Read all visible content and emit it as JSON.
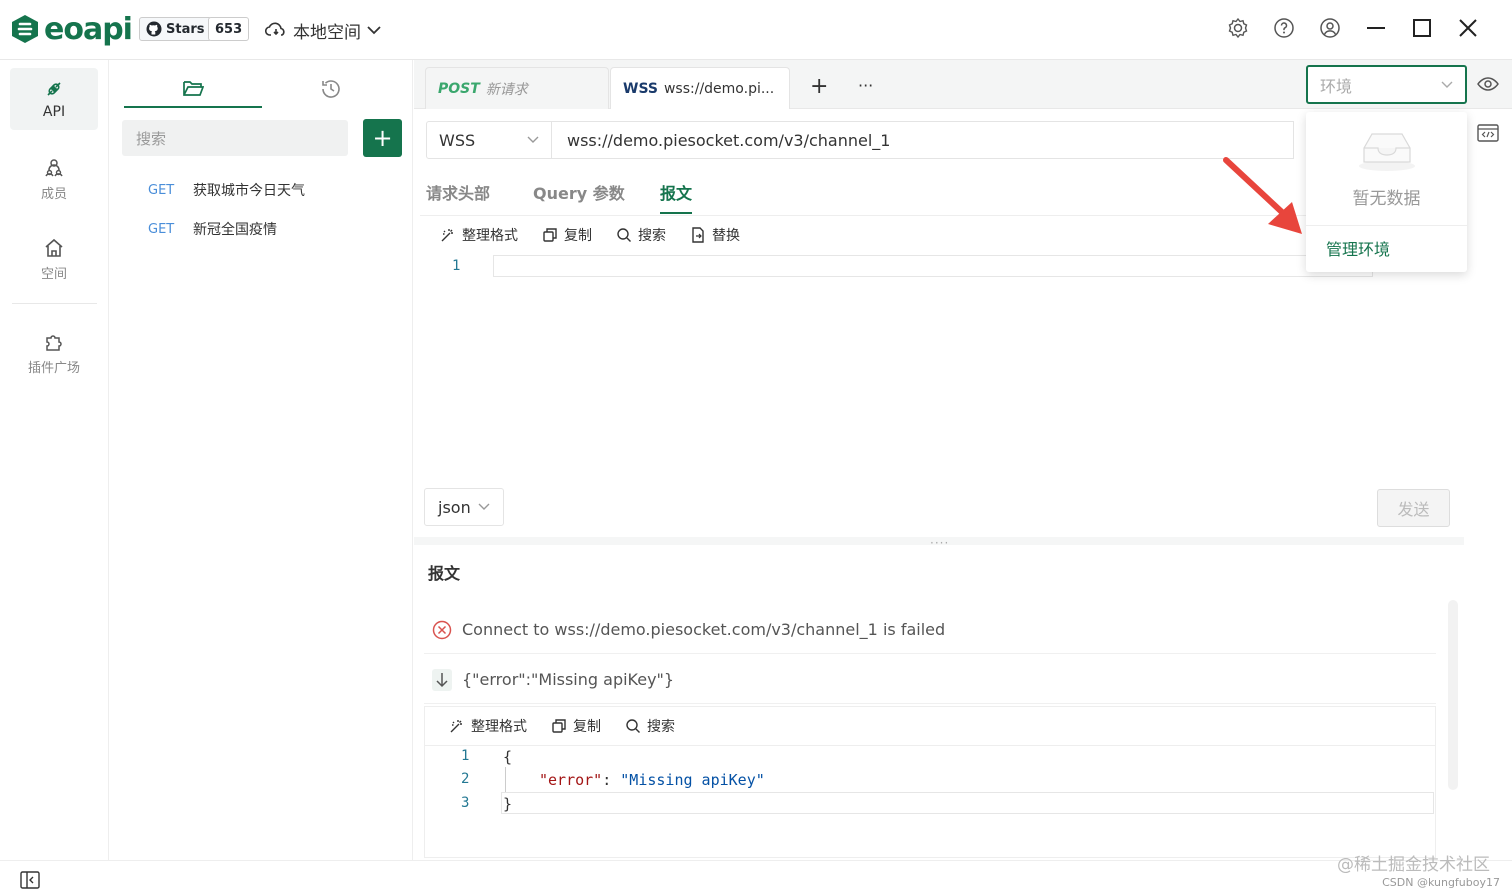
{
  "app": {
    "logo_text": "eoapi",
    "stars_label": "Stars",
    "stars_count": "653",
    "workspace": "本地空间"
  },
  "leftnav": {
    "items": [
      {
        "label": "API"
      },
      {
        "label": "成员"
      },
      {
        "label": "空间"
      },
      {
        "label": "插件广场"
      }
    ]
  },
  "sidebar": {
    "search_placeholder": "搜索",
    "add_label": "+",
    "apis": [
      {
        "method": "GET",
        "name": "获取城市今日天气"
      },
      {
        "method": "GET",
        "name": "新冠全国疫情"
      }
    ]
  },
  "tabs": [
    {
      "method": "POST",
      "title": "新请求"
    },
    {
      "method": "WSS",
      "title": "wss://demo.pi..."
    }
  ],
  "tab_controls": {
    "add": "+",
    "more": "···"
  },
  "env": {
    "placeholder": "环境",
    "empty_text": "暂无数据",
    "manage_label": "管理环境"
  },
  "request": {
    "method": "WSS",
    "url": "wss://demo.piesocket.com/v3/channel_1",
    "sub_tabs": [
      "请求头部",
      "Query 参数",
      "报文"
    ],
    "toolbar": [
      "整理格式",
      "复制",
      "搜索",
      "替换"
    ],
    "line_numbers": [
      "1"
    ],
    "format": "json",
    "send_label": "发送"
  },
  "response": {
    "title": "报文",
    "messages": [
      {
        "type": "error",
        "text": "Connect to wss://demo.piesocket.com/v3/channel_1 is failed"
      },
      {
        "type": "received",
        "text": "{\"error\":\"Missing apiKey\"}"
      }
    ],
    "toolbar": [
      "整理格式",
      "复制",
      "搜索"
    ],
    "code_lines": [
      {
        "no": "1",
        "text": "{"
      },
      {
        "no": "2",
        "key": "\"error\"",
        "colon": ": ",
        "value": "\"Missing apiKey\""
      },
      {
        "no": "3",
        "text": "}"
      }
    ]
  },
  "watermark": {
    "line1": "@稀土掘金技术社区",
    "line2": "CSDN @kungfuboy17"
  },
  "colors": {
    "brand": "#15744d",
    "method_get": "#4a8ed9",
    "method_post": "#3aa76d",
    "error": "#d9534f"
  }
}
